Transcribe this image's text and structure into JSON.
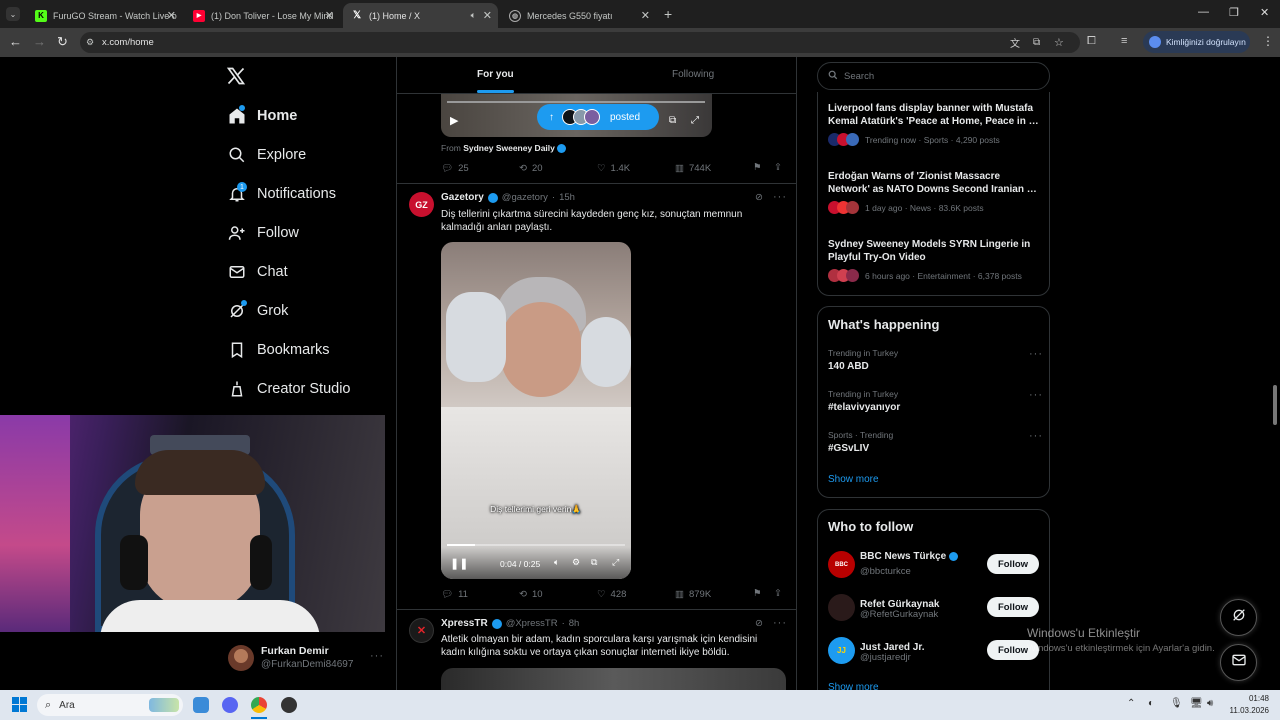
{
  "browser": {
    "tabs": [
      {
        "title": "FuruGO Stream - Watch Live o",
        "icon": "kick-icon",
        "active": false
      },
      {
        "title": "(1) Don Toliver - Lose My Mind",
        "icon": "youtube-icon",
        "active": false
      },
      {
        "title": "(1) Home / X",
        "icon": "x-icon",
        "active": true
      },
      {
        "title": "Mercedes G550 fiyatı",
        "icon": "globe-icon",
        "active": false
      }
    ],
    "url": "x.com/home",
    "profile_button": "Kimliğinizi doğrulayın"
  },
  "sidebar": {
    "items": [
      {
        "label": "Home",
        "icon": "home-icon"
      },
      {
        "label": "Explore",
        "icon": "search-icon"
      },
      {
        "label": "Notifications",
        "icon": "bell-icon",
        "badge": "1"
      },
      {
        "label": "Follow",
        "icon": "person-add-icon"
      },
      {
        "label": "Chat",
        "icon": "mail-icon"
      },
      {
        "label": "Grok",
        "icon": "grok-icon"
      },
      {
        "label": "Bookmarks",
        "icon": "bookmark-icon"
      },
      {
        "label": "Creator Studio",
        "icon": "creator-icon"
      }
    ],
    "account": {
      "name": "Furkan Demir",
      "handle": "@FurkanDemi84697"
    }
  },
  "feed": {
    "tabs": [
      "For you",
      "Following"
    ],
    "posted_pill": "posted",
    "post0": {
      "from_label": "From",
      "from": "Sydney Sweeney Daily",
      "stats": {
        "replies": "25",
        "reposts": "20",
        "likes": "1.4K",
        "views": "744K"
      }
    },
    "post1": {
      "name": "Gazetory",
      "handle": "@gazetory",
      "time": "15h",
      "avatar": "GZ",
      "text": "Diş tellerini çıkartma sürecini kaydeden genç kız, sonuçtan memnun kalmadığı anları paylaştı.",
      "subtitle": "Diş tellerimi geri verin🙏",
      "video_time": "0:04 / 0:25",
      "stats": {
        "replies": "11",
        "reposts": "10",
        "likes": "428",
        "views": "879K"
      }
    },
    "post2": {
      "name": "XpressTR",
      "handle": "@XpressTR",
      "time": "8h",
      "text": "Atletik olmayan bir adam, kadın sporculara karşı yarışmak için kendisini kadın kılığına soktu ve ortaya çıkan sonuçlar interneti ikiye böldü."
    }
  },
  "right": {
    "search_placeholder": "Search",
    "news": [
      {
        "title": "Liverpool fans display banner with Mustafa Kemal Atatürk's 'Peace at Home, Peace in …",
        "meta": "Trending now · Sports · 4,290 posts"
      },
      {
        "title": "Erdoğan Warns of 'Zionist Massacre Network' as NATO Downs Second Iranian …",
        "meta": "1 day ago · News · 83.6K posts"
      },
      {
        "title": "Sydney Sweeney Models SYRN Lingerie in Playful Try-On Video",
        "meta": "6 hours ago · Entertainment · 6,378 posts"
      }
    ],
    "happening": {
      "title": "What's happening",
      "trends": [
        {
          "context": "Trending in Turkey",
          "name": "140 ABD"
        },
        {
          "context": "Trending in Turkey",
          "name": "#telavivyanıyor"
        },
        {
          "context": "Sports · Trending",
          "name": "#GSvLIV"
        }
      ],
      "show_more": "Show more"
    },
    "who_to_follow": {
      "title": "Who to follow",
      "follow_label": "Follow",
      "accounts": [
        {
          "name": "BBC News Türkçe",
          "handle": "@bbcturkce",
          "verified": true
        },
        {
          "name": "Refet Gürkaynak",
          "handle": "@RefetGurkaynak",
          "verified": false
        },
        {
          "name": "Just Jared Jr.",
          "handle": "@justjaredjr",
          "verified": false
        }
      ],
      "show_more": "Show more"
    }
  },
  "watermark": {
    "title": "Windows'u Etkinleştir",
    "subtitle": "Windows'u etkinleştirmek için Ayarlar'a gidin."
  },
  "taskbar": {
    "search_placeholder": "Ara",
    "time": "01:48",
    "date": "11.03.2026"
  },
  "colors": {
    "accent": "#1d9bf0",
    "background": "#000000",
    "border": "#2f3336",
    "muted": "#71767b"
  }
}
